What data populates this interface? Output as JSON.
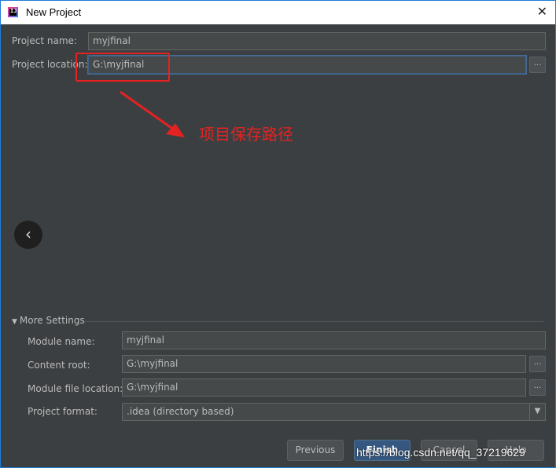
{
  "window": {
    "title": "New Project",
    "app_icon_text": "IJ"
  },
  "form": {
    "project_name_label": "Project name:",
    "project_name_value": "myjfinal",
    "project_location_label": "Project location:",
    "project_location_value": "G:\\myjfinal",
    "browse_label": "..."
  },
  "annotation": {
    "text": "项目保存路径",
    "color": "#e52222"
  },
  "more_settings": {
    "header": "More Settings",
    "module_name_label": "Module name:",
    "module_name_value": "myjfinal",
    "content_root_label": "Content root:",
    "content_root_value": "G:\\myjfinal",
    "module_file_location_label": "Module file location:",
    "module_file_location_value": "G:\\myjfinal",
    "project_format_label": "Project format:",
    "project_format_value": ".idea (directory based)"
  },
  "buttons": {
    "previous": "Previous",
    "finish": "Finish",
    "cancel": "Cancel",
    "help": "Help"
  },
  "watermark": "https://blog.csdn.net/qq_37219629",
  "colors": {
    "background": "#3c3f41",
    "accent": "#365880",
    "annotation_red": "#e52222"
  }
}
